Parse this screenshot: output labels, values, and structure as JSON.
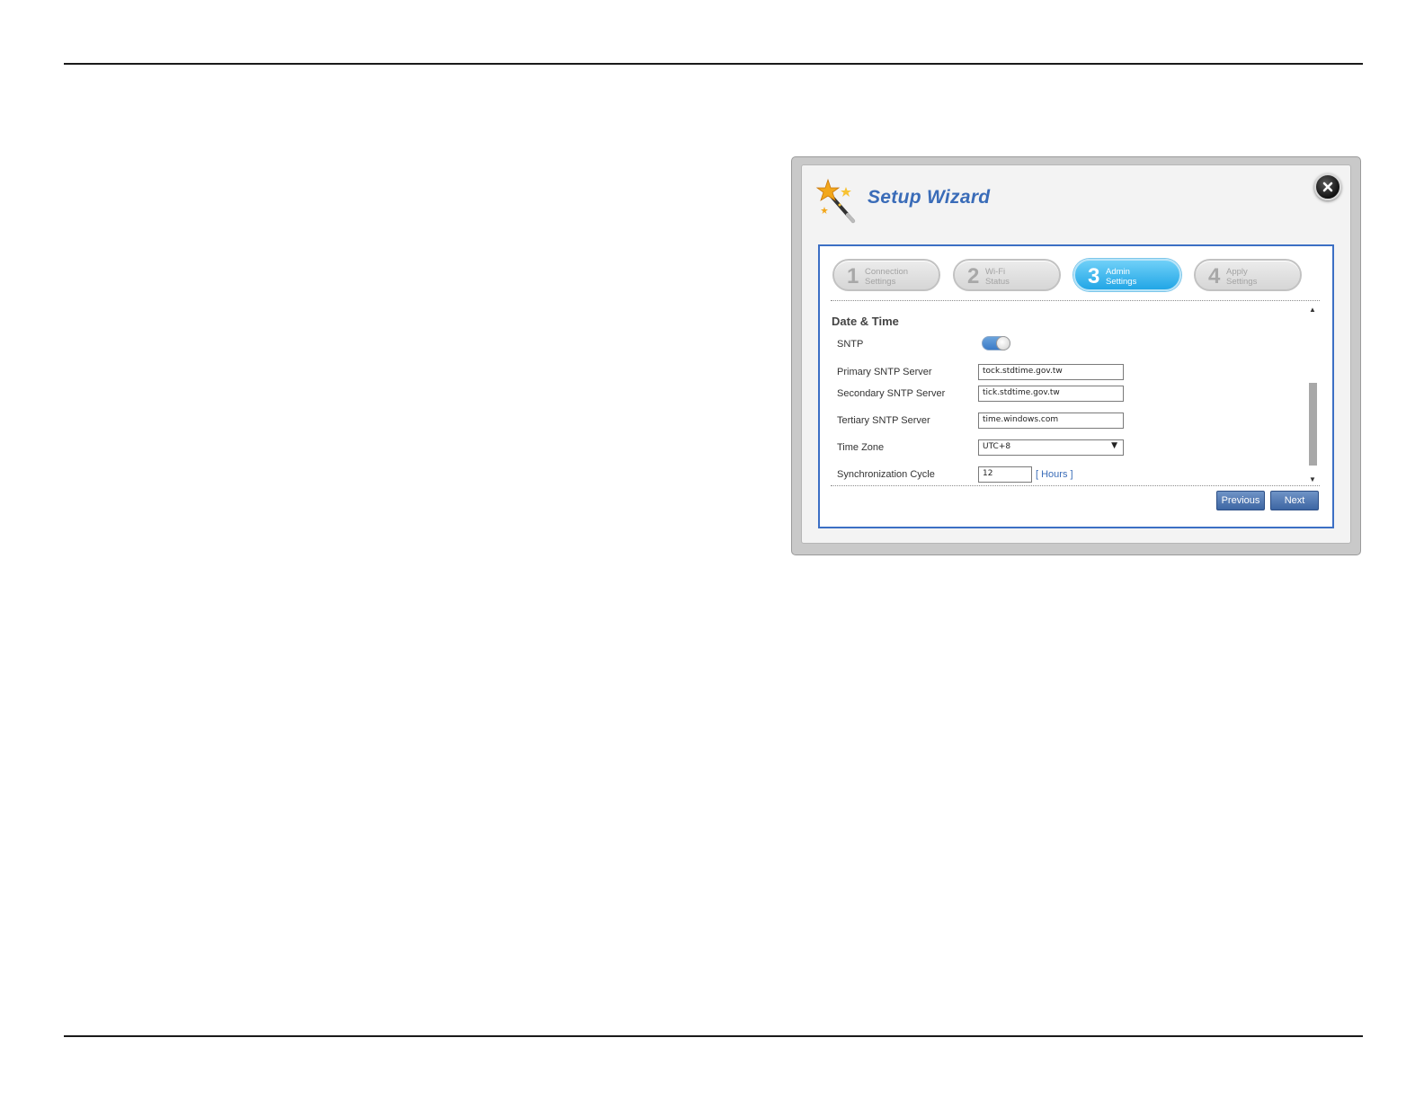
{
  "wizard": {
    "title": "Setup Wizard",
    "steps": [
      {
        "num": "1",
        "line1": "Connection",
        "line2": "Settings",
        "active": false
      },
      {
        "num": "2",
        "line1": "Wi-Fi",
        "line2": "Status",
        "active": false
      },
      {
        "num": "3",
        "line1": "Admin",
        "line2": "Settings",
        "active": true
      },
      {
        "num": "4",
        "line1": "Apply",
        "line2": "Settings",
        "active": false
      }
    ],
    "section_title": "Date & Time",
    "sntp": {
      "label": "SNTP",
      "enabled": true
    },
    "primary": {
      "label": "Primary SNTP Server",
      "value": "tock.stdtime.gov.tw"
    },
    "secondary": {
      "label": "Secondary SNTP Server",
      "value": "tick.stdtime.gov.tw"
    },
    "tertiary": {
      "label": "Tertiary SNTP Server",
      "value": "time.windows.com"
    },
    "timezone": {
      "label": "Time Zone",
      "value": "UTC+8"
    },
    "sync": {
      "label": "Synchronization Cycle",
      "value": "12",
      "unit": "[ Hours ]"
    },
    "previous_label": "Previous",
    "next_label": "Next"
  },
  "colors": {
    "accent": "#3a6cb8",
    "active_step": "#22a6e6",
    "button": "#3d66a3"
  },
  "icons": {
    "header": "magic-wand-icon",
    "close": "close-icon",
    "toggle": "toggle-switch"
  }
}
